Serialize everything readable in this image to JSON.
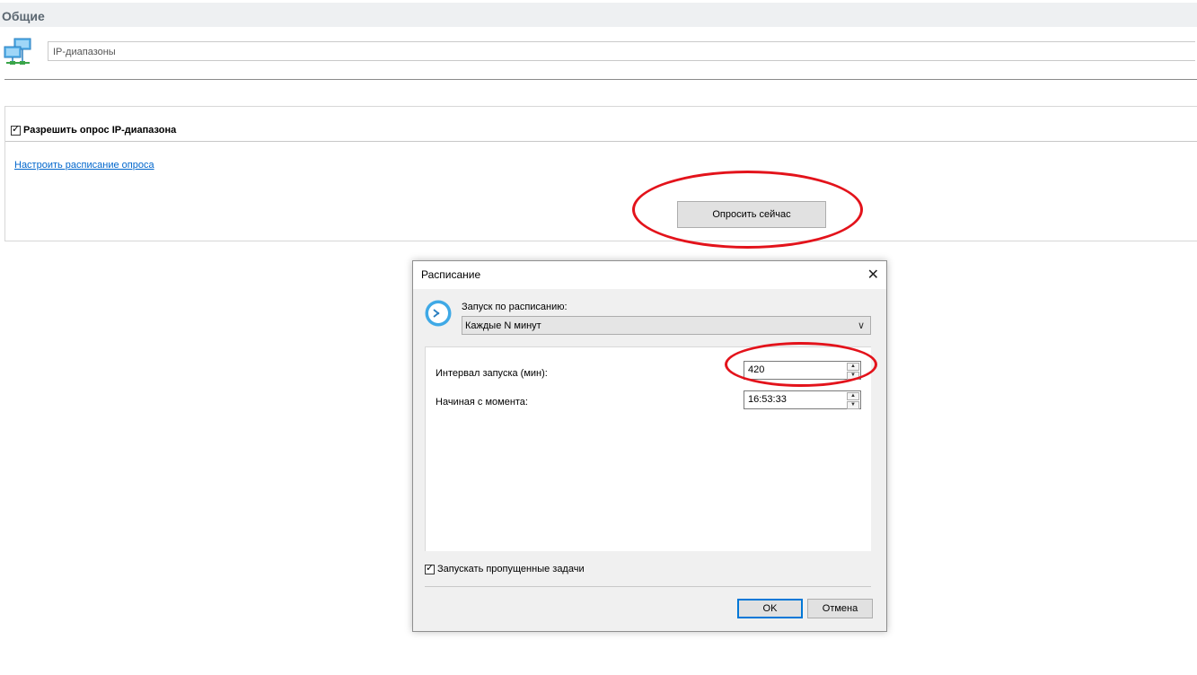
{
  "header": {
    "title": "Общие"
  },
  "name_field": {
    "value": "IP-диапазоны"
  },
  "panel": {
    "allow_poll_label": "Разрешить опрос IP-диапазона",
    "allow_poll_checked": true,
    "schedule_link": "Настроить расписание опроса",
    "poll_now_button": "Опросить сейчас"
  },
  "dialog": {
    "title": "Расписание",
    "close_glyph": "✕",
    "schedule_label": "Запуск по расписанию:",
    "schedule_value": "Каждые N минут",
    "interval_label": "Интервал запуска (мин):",
    "interval_value": "420",
    "start_label": "Начиная с момента:",
    "start_value": "16:53:33",
    "run_missed_label": "Запускать пропущенные задачи",
    "run_missed_checked": true,
    "ok_button": "OK",
    "cancel_button": "Отмена"
  },
  "icons": {
    "network": "network-computers-icon",
    "clock": "clock-icon",
    "chevron": "chevron-down-icon"
  },
  "colors": {
    "annotation_red": "#e3131b",
    "link_blue": "#0066cc",
    "focus_blue": "#0078d7",
    "clock_blue": "#3fa9e6"
  }
}
